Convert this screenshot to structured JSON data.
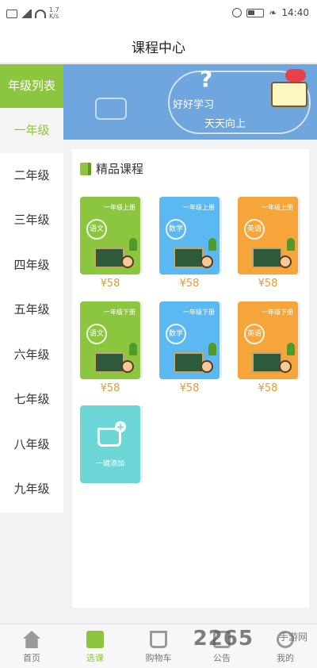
{
  "status_bar": {
    "time": "14:40",
    "speed": "1.7",
    "speed_unit": "K/s"
  },
  "header": {
    "title": "课程中心"
  },
  "sidebar": {
    "heading": "年级列表",
    "grades": [
      "一年级",
      "二年级",
      "三年级",
      "四年级",
      "五年级",
      "六年级",
      "七年级",
      "八年级",
      "九年级"
    ],
    "active_index": 0
  },
  "banner": {
    "line1": "好好学习",
    "line2": "天天向上",
    "mark": "?"
  },
  "section": {
    "title": "精品课程"
  },
  "courses": [
    {
      "top_label": "一年级上册",
      "subject": "语文",
      "price": "¥58",
      "color": "#8cc63f"
    },
    {
      "top_label": "一年级上册",
      "subject": "数学",
      "price": "¥58",
      "color": "#5cb8f0"
    },
    {
      "top_label": "一年级上册",
      "subject": "英语",
      "price": "¥58",
      "color": "#f5a53a"
    },
    {
      "top_label": "一年级下册",
      "subject": "语文",
      "price": "¥58",
      "color": "#8cc63f"
    },
    {
      "top_label": "一年级下册",
      "subject": "数学",
      "price": "¥58",
      "color": "#5cb8f0"
    },
    {
      "top_label": "一年级下册",
      "subject": "英语",
      "price": "¥58",
      "color": "#f5a53a"
    }
  ],
  "add_card": {
    "label": "一键添加",
    "plus": "+"
  },
  "bottom_nav": [
    {
      "label": "首页",
      "icon": "home-icon"
    },
    {
      "label": "选课",
      "icon": "course-select-icon",
      "active": true
    },
    {
      "label": "购物车",
      "icon": "cart-icon"
    },
    {
      "label": "公告",
      "icon": "notice-icon"
    },
    {
      "label": "我的",
      "icon": "profile-icon"
    }
  ],
  "watermark": {
    "brand": "2265",
    "site": "手游网"
  },
  "colors": {
    "accent": "#8cc63f",
    "banner": "#6ea6dd",
    "price": "#e89a2a"
  }
}
